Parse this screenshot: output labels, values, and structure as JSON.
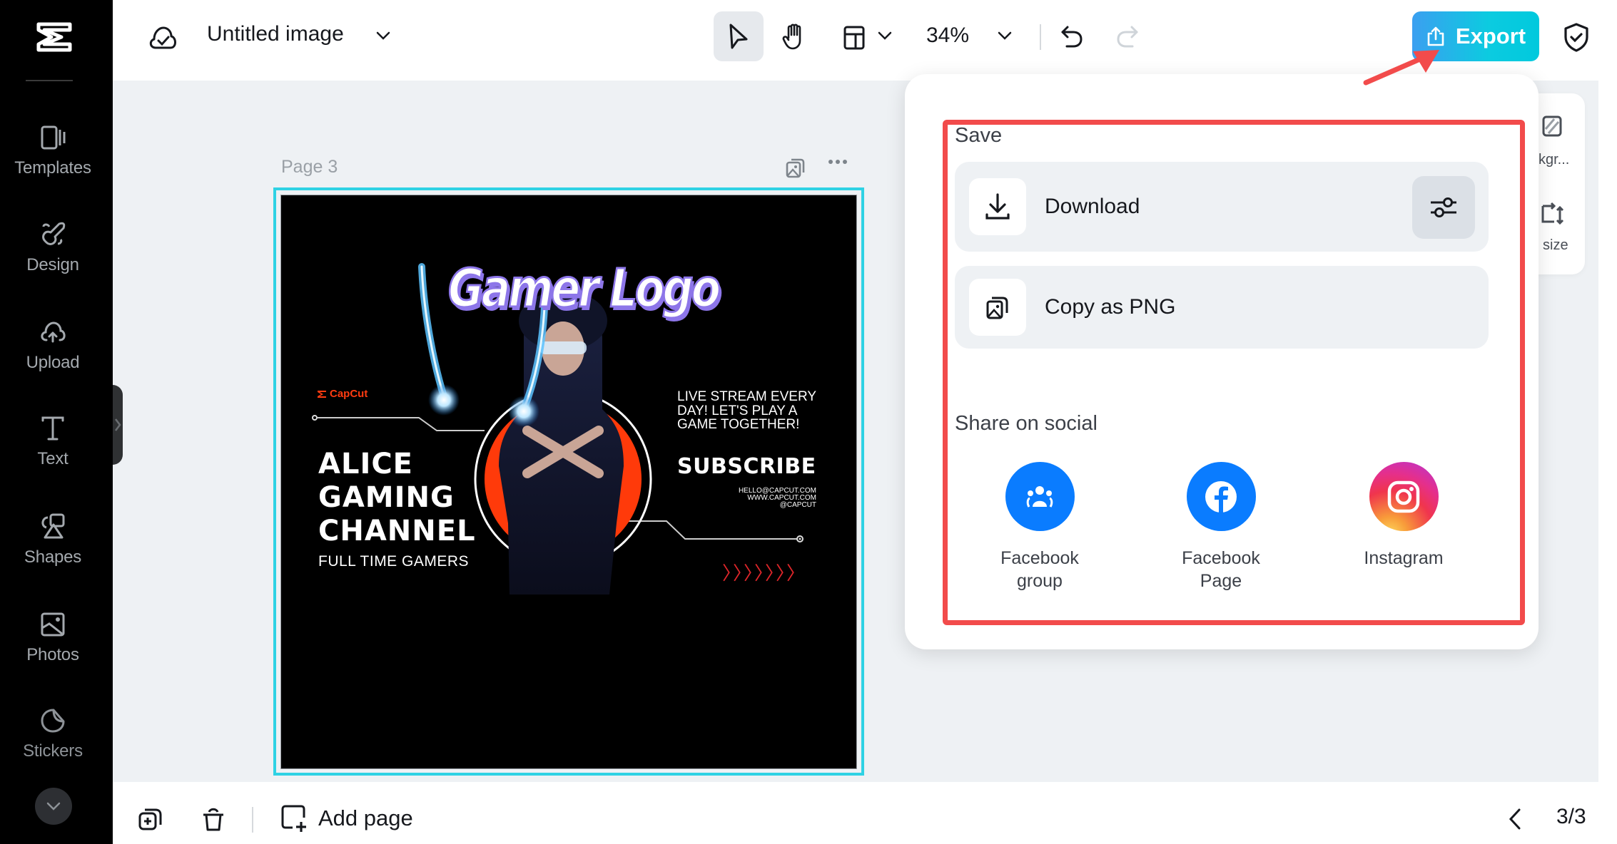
{
  "app": {
    "title": "Untitled image",
    "zoom": "34%"
  },
  "sidebar": {
    "items": [
      {
        "label": "Templates",
        "icon": "templates-icon"
      },
      {
        "label": "Design",
        "icon": "design-icon"
      },
      {
        "label": "Upload",
        "icon": "upload-cloud-icon"
      },
      {
        "label": "Text",
        "icon": "text-icon"
      },
      {
        "label": "Shapes",
        "icon": "shapes-icon"
      },
      {
        "label": "Photos",
        "icon": "photo-icon"
      },
      {
        "label": "Stickers",
        "icon": "sticker-icon"
      }
    ]
  },
  "toolbar": {
    "export_label": "Export"
  },
  "canvas": {
    "page_label": "Page 3",
    "poster": {
      "headline": "Gamer Logo",
      "brand": "CapCut",
      "title_lines": [
        "ALICE",
        "GAMING",
        "CHANNEL"
      ],
      "subtitle": "FULL TIME GAMERS",
      "tagline": "LIVE STREAM EVERY DAY! LET'S PLAY A GAME TOGETHER!",
      "cta": "SUBSCRIBE",
      "contact": [
        "HELLO@CAPCUT.COM",
        "WWW.CAPCUT.COM",
        "@CAPCUT"
      ],
      "chevrons": "〉〉〉〉〉〉〉"
    }
  },
  "right_panel": {
    "items": [
      {
        "label": "kgr...",
        "icon": "remove-background-icon"
      },
      {
        "label": "size",
        "icon": "resize-icon"
      }
    ]
  },
  "bottom": {
    "add_page_label": "Add page",
    "page_indicator": "3/3"
  },
  "export_popup": {
    "save_title": "Save",
    "download_label": "Download",
    "copy_png_label": "Copy as PNG",
    "share_title": "Share on social",
    "social": [
      {
        "label": "Facebook group",
        "line1": "Facebook",
        "line2": "group",
        "color": "#0a7cff"
      },
      {
        "label": "Facebook Page",
        "line1": "Facebook",
        "line2": "Page",
        "color": "#0a7cff"
      },
      {
        "label": "Instagram",
        "line1": "Instagram",
        "line2": "",
        "color": "#e1306c"
      }
    ]
  },
  "colors": {
    "accent": "#00c9dd",
    "selection": "#2fd2e4",
    "highlight": "#f24b4b",
    "sidebar_bg": "#000000"
  }
}
